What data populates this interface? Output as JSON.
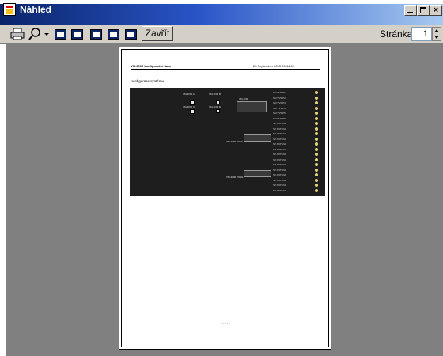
{
  "window": {
    "title": "Náhled"
  },
  "toolbar": {
    "close_label": "Zavřít",
    "page_label": "Stránka",
    "page_value": "1"
  },
  "document": {
    "header_left": "VM-3000 konfigurační data",
    "header_right": "23 September 2015 20:44:49",
    "section_title": "Konfigurace systému",
    "footer": "- 1 -"
  },
  "diagram": {
    "device_labels": [
      "VM-3000 A",
      "VM-3000 B",
      "VM-3000 C",
      "VM-3000 D"
    ],
    "switch_label": "VM-3000",
    "zone_labels": [
      "VM-3000 ZONE",
      "VM-3000 ZONE"
    ],
    "ports": [
      "SM VVS P1",
      "SM VVS P2",
      "SM VVS P3",
      "SM VVS P4",
      "SM VVS P5",
      "SM VVS P6",
      "SP ANTENA",
      "SP ANTENA",
      "SP ANTENA",
      "SP ANTENA",
      "SP ANTENA",
      "SP ANTENA",
      "SP ANTENA",
      "SP ANTENA",
      "SP ANTENA",
      "SP ANTENA",
      "SP ANTENA",
      "SP ANTENA",
      "SP ANTENA",
      "SP ANTENA"
    ]
  }
}
